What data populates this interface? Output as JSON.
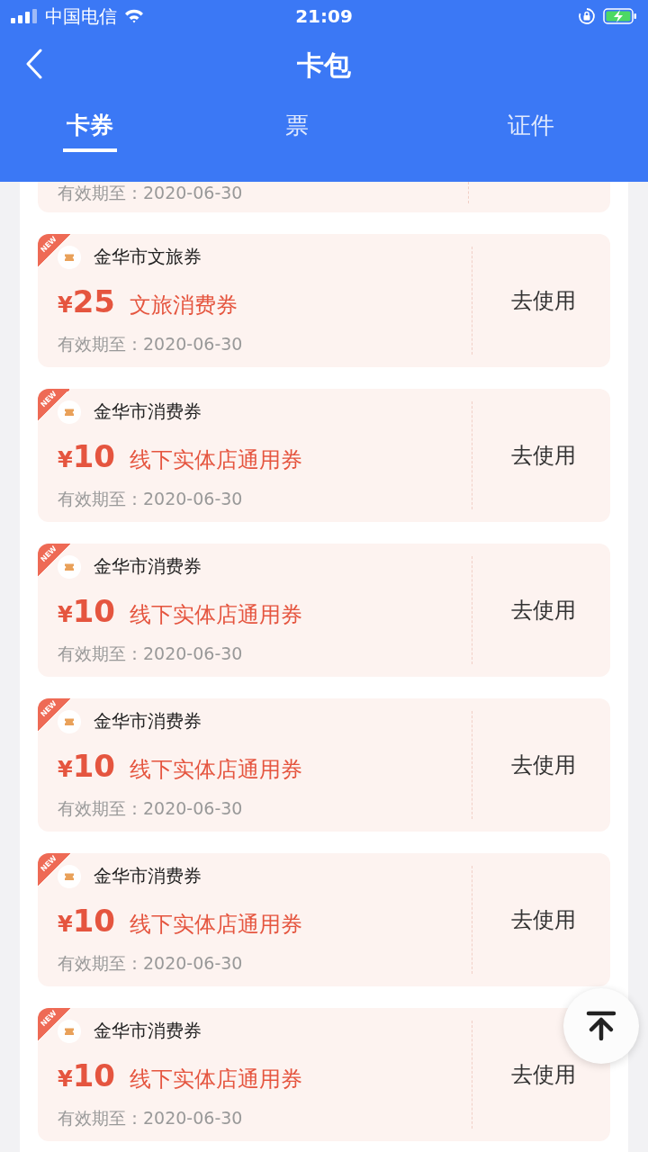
{
  "status_bar": {
    "carrier": "中国电信",
    "time": "21:09"
  },
  "header": {
    "title": "卡包"
  },
  "tabs": [
    {
      "label": "卡券",
      "selected": true
    },
    {
      "label": "票",
      "selected": false
    },
    {
      "label": "证件",
      "selected": false
    }
  ],
  "coupons": [
    {
      "kind": "partial",
      "expiry": "有效期至：2020-06-30"
    },
    {
      "kind": "full",
      "badge": "NEW",
      "issuer": "金华市文旅券",
      "currency": "¥",
      "amount": "25",
      "name": "文旅消费券",
      "expiry": "有效期至：2020-06-30",
      "action": "去使用"
    },
    {
      "kind": "full",
      "badge": "NEW",
      "issuer": "金华市消费券",
      "currency": "¥",
      "amount": "10",
      "name": "线下实体店通用券",
      "expiry": "有效期至：2020-06-30",
      "action": "去使用"
    },
    {
      "kind": "full",
      "badge": "NEW",
      "issuer": "金华市消费券",
      "currency": "¥",
      "amount": "10",
      "name": "线下实体店通用券",
      "expiry": "有效期至：2020-06-30",
      "action": "去使用"
    },
    {
      "kind": "full",
      "badge": "NEW",
      "issuer": "金华市消费券",
      "currency": "¥",
      "amount": "10",
      "name": "线下实体店通用券",
      "expiry": "有效期至：2020-06-30",
      "action": "去使用"
    },
    {
      "kind": "full",
      "badge": "NEW",
      "issuer": "金华市消费券",
      "currency": "¥",
      "amount": "10",
      "name": "线下实体店通用券",
      "expiry": "有效期至：2020-06-30",
      "action": "去使用"
    },
    {
      "kind": "full",
      "badge": "NEW",
      "issuer": "金华市消费券",
      "currency": "¥",
      "amount": "10",
      "name": "线下实体店通用券",
      "expiry": "有效期至：2020-06-30",
      "action": "去使用"
    }
  ]
}
